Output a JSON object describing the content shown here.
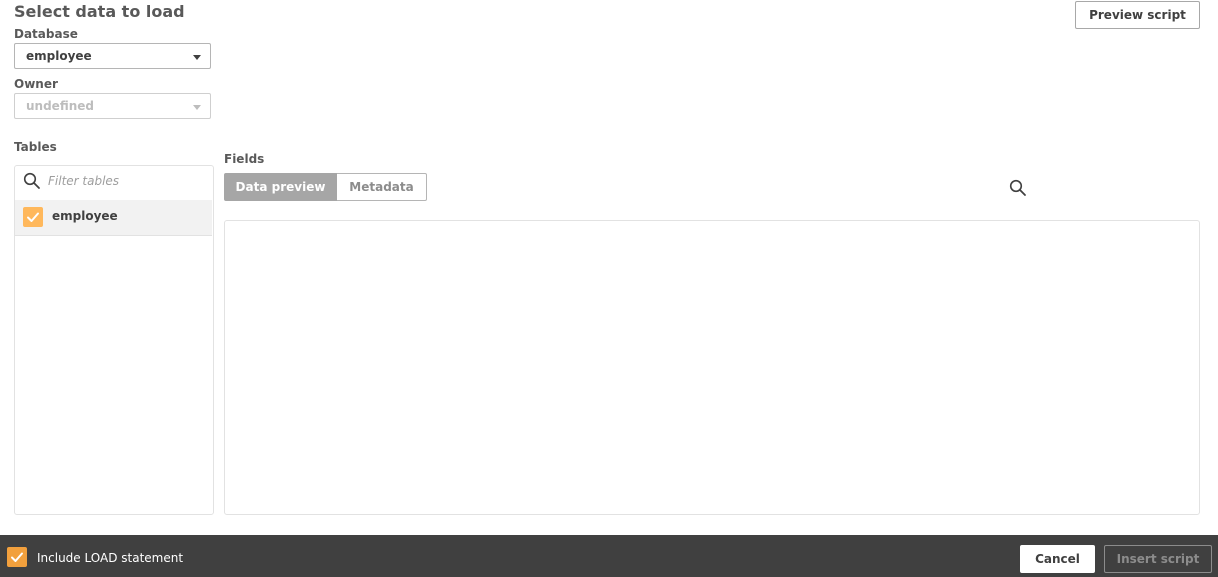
{
  "dialog": {
    "title": "Select data to load",
    "preview_script_label": "Preview script"
  },
  "database": {
    "label": "Database",
    "selected": "employee"
  },
  "owner": {
    "label": "Owner",
    "selected": "undefined"
  },
  "tables": {
    "label": "Tables",
    "filter_placeholder": "Filter tables",
    "items": [
      {
        "name": "employee",
        "checked": true
      }
    ]
  },
  "fields": {
    "label": "Fields",
    "tabs": [
      {
        "label": "Data preview",
        "active": true
      },
      {
        "label": "Metadata",
        "active": false
      }
    ]
  },
  "footer": {
    "include_load_label": "Include LOAD statement",
    "include_load_checked": true,
    "cancel_label": "Cancel",
    "insert_script_label": "Insert script"
  },
  "icons": {
    "search": "search-icon",
    "check": "check-icon",
    "caret": "caret-down-icon"
  },
  "colors": {
    "accent": "#ffb85c",
    "footer_bg": "#404040",
    "tab_active": "#a6a6a6"
  }
}
